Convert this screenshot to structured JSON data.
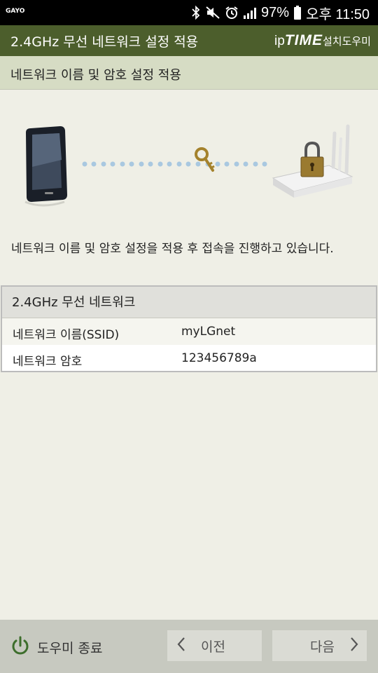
{
  "status_bar": {
    "carrier": "GAYO",
    "battery": "97%",
    "time": "오후 11:50"
  },
  "title_bar": {
    "title": "2.4GHz 무선 네트워크 설정 적용",
    "brand_ip": "ip",
    "brand_time": "TIME",
    "brand_wizard": "설치도우미"
  },
  "subheader": {
    "title": "네트워크 이름 및 암호 설정 적용"
  },
  "description": "네트워크 이름 및 암호 설정을 적용 후 접속을 진행하고 있습니다.",
  "network": {
    "header": "2.4GHz 무선 네트워크",
    "rows": [
      {
        "label": "네트워크 이름(SSID)",
        "value": "myLGnet"
      },
      {
        "label": "네트워크 암호",
        "value": "123456789a"
      }
    ]
  },
  "footer": {
    "exit_label": "도우미 종료",
    "prev_label": "이전",
    "next_label": "다음"
  },
  "colors": {
    "title_bar": "#4c5e2c",
    "subheader": "#d6dcc4",
    "background": "#efefe6",
    "footer": "#c7c9c0",
    "dots": "#a9c8e0"
  }
}
